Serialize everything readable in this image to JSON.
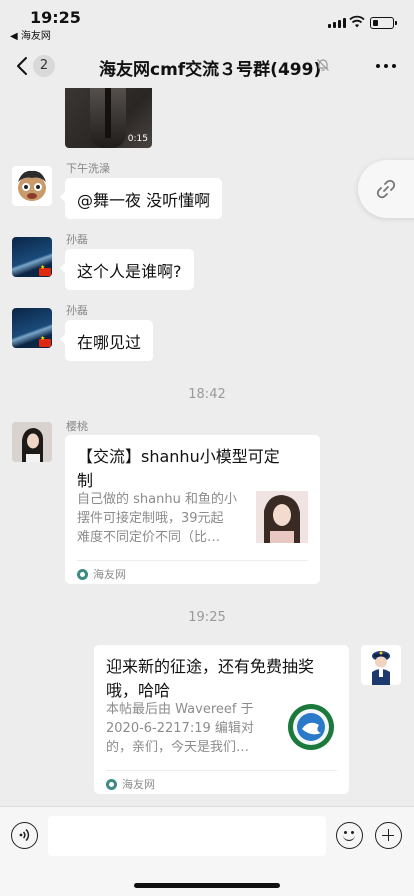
{
  "status_bar": {
    "time": "19:25",
    "back_app": "◀ 海友网",
    "battery_level": 0.3
  },
  "nav": {
    "back_icon": "chevron-left-icon",
    "unread_count": "2",
    "title": "海友网cmf交流３号群(499)",
    "mute_icon": "bell-muted-icon",
    "more_icon": "more-horizontal-icon"
  },
  "video_message": {
    "duration": "0:15"
  },
  "messages": [
    {
      "sender": "下午洗澡",
      "text": "@舞一夜 没听懂啊"
    },
    {
      "sender": "孙磊",
      "text": "这个人是谁啊?"
    },
    {
      "sender": "孙磊",
      "text": "在哪见过"
    }
  ],
  "timestamps": [
    "18:42",
    "19:25"
  ],
  "link_cards": [
    {
      "sender": "樱桃",
      "title": "【交流】shanhu小模型可定\n制",
      "description": "自己做的 shanhu 和鱼的小\n摆件可接定制哦，39元起\n难度不同定价不同（比…",
      "source": "海友网"
    },
    {
      "title": "迎来新的征途，还有免费抽奖\n哦，哈哈",
      "description": "本帖最后由 Wavereef 于\n2020-6-2217:19 编辑对\n的，亲们，今天是我们…",
      "source": "海友网"
    }
  ],
  "floating_button": {
    "icon": "link-icon"
  },
  "input_bar": {
    "voice_icon": "voice-icon",
    "text_value": "",
    "emoji_icon": "emoji-icon",
    "plus_icon": "plus-icon"
  }
}
